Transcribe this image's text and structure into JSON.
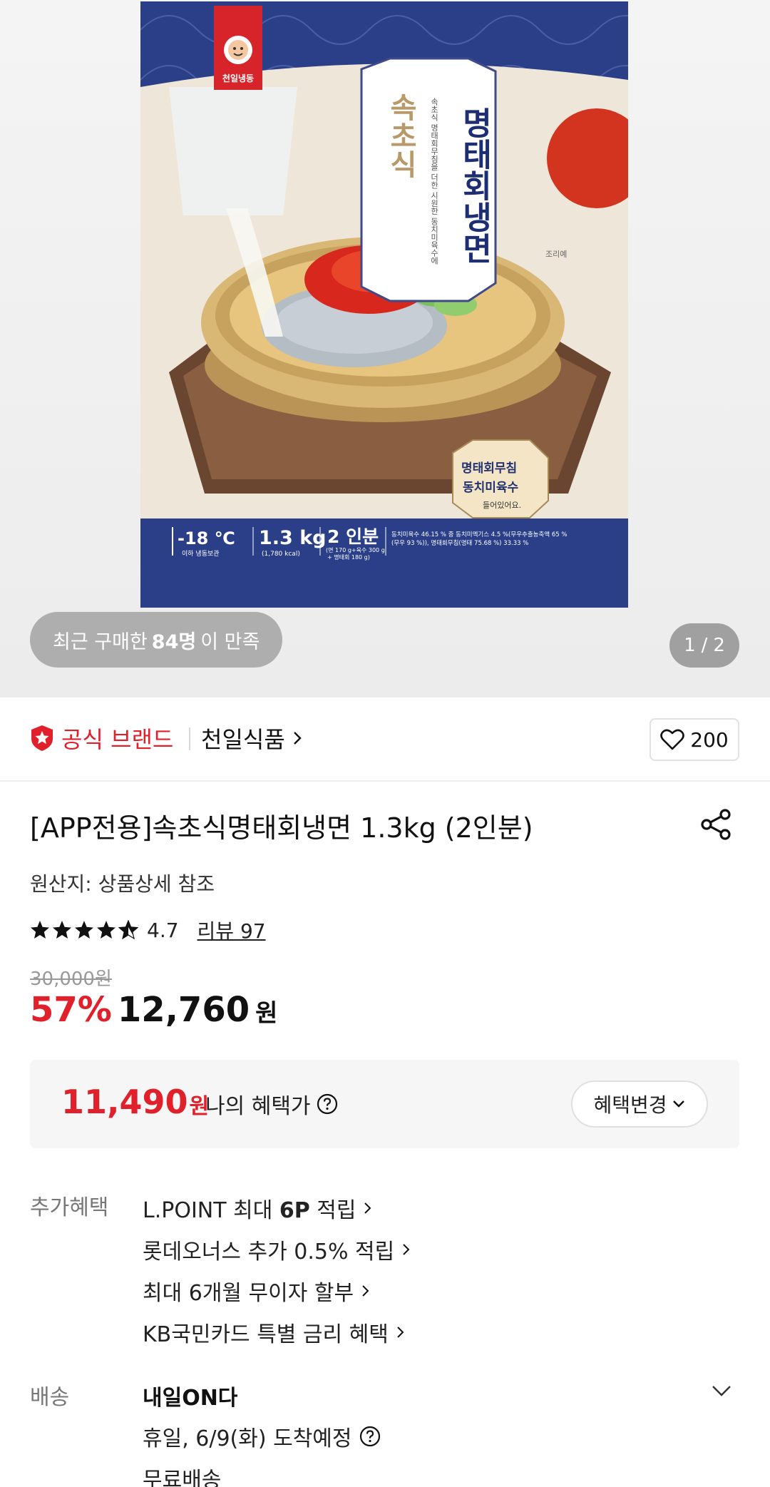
{
  "hero": {
    "package": {
      "brand_logo": "천일냉동",
      "subtitle_side": "속초식",
      "title_vertical": "명태회냉면",
      "desc_vertical": "속초식 명태회무침을 더한 시원한 동치미육수에",
      "badge_corner": "조리예",
      "sticker_line1": "명태회무침",
      "sticker_line2": "동치미육수",
      "sticker_line3": "들어있어요.",
      "temp": "-18 ℃",
      "temp_sub": "이하 냉동보관",
      "weight": "1.3 kg",
      "weight_sub": "(1,780 kcal)",
      "servings": "2 인분",
      "servings_sub": "(면 170 g+육수 300 g",
      "servings_sub2": "+ 명태회 180 g)",
      "ingredients_line1": "동치미육수 46.15 % 중 동치미엑기스 4.5 %(무우추출농축액 65 %",
      "ingredients_line2": "(무우 93 %)), 명태회무침(명태 75.68 %) 33.33 %"
    },
    "satisfied_prefix": "최근 구매한 ",
    "satisfied_count": "84명",
    "satisfied_suffix": "이 만족",
    "page_current": "1",
    "page_sep": "/",
    "page_total": "2"
  },
  "brand": {
    "official_label": "공식 브랜드",
    "brand_name": "천일식품",
    "like_count": "200"
  },
  "product": {
    "title": "[APP전용]속초식명태회냉면 1.3kg (2인분)",
    "origin": "원산지: 상품상세 참조",
    "rating": 4.7,
    "rating_text": "4.7",
    "review_text": "리뷰 97",
    "original_price": "30,000원",
    "discount": "57%",
    "sale_price": "12,760",
    "sale_unit": "원"
  },
  "benefit": {
    "price": "11,490",
    "unit": "원",
    "label": "나의 혜택가",
    "change_label": "혜택변경"
  },
  "extra": {
    "label": "추가혜택",
    "items": [
      {
        "pre": "L.POINT 최대 ",
        "bold": "6P",
        "post": " 적립"
      },
      {
        "pre": "롯데오너스 추가 0.5% 적립",
        "bold": "",
        "post": ""
      },
      {
        "pre": "최대 6개월 무이자 할부",
        "bold": "",
        "post": ""
      },
      {
        "pre": "KB국민카드 특별 금리 혜택",
        "bold": "",
        "post": ""
      }
    ]
  },
  "shipping": {
    "label": "배송",
    "title": "내일ON다",
    "arrival": "휴일, 6/9(화) 도착예정",
    "fee": "무료배송"
  },
  "colors": {
    "accent_red": "#e0202b",
    "package_blue": "#2b3f88"
  },
  "icons": [
    "star-badge-icon",
    "chevron-right-icon",
    "heart-icon",
    "share-icon",
    "star-icon",
    "question-circle-icon",
    "chevron-down-icon"
  ]
}
